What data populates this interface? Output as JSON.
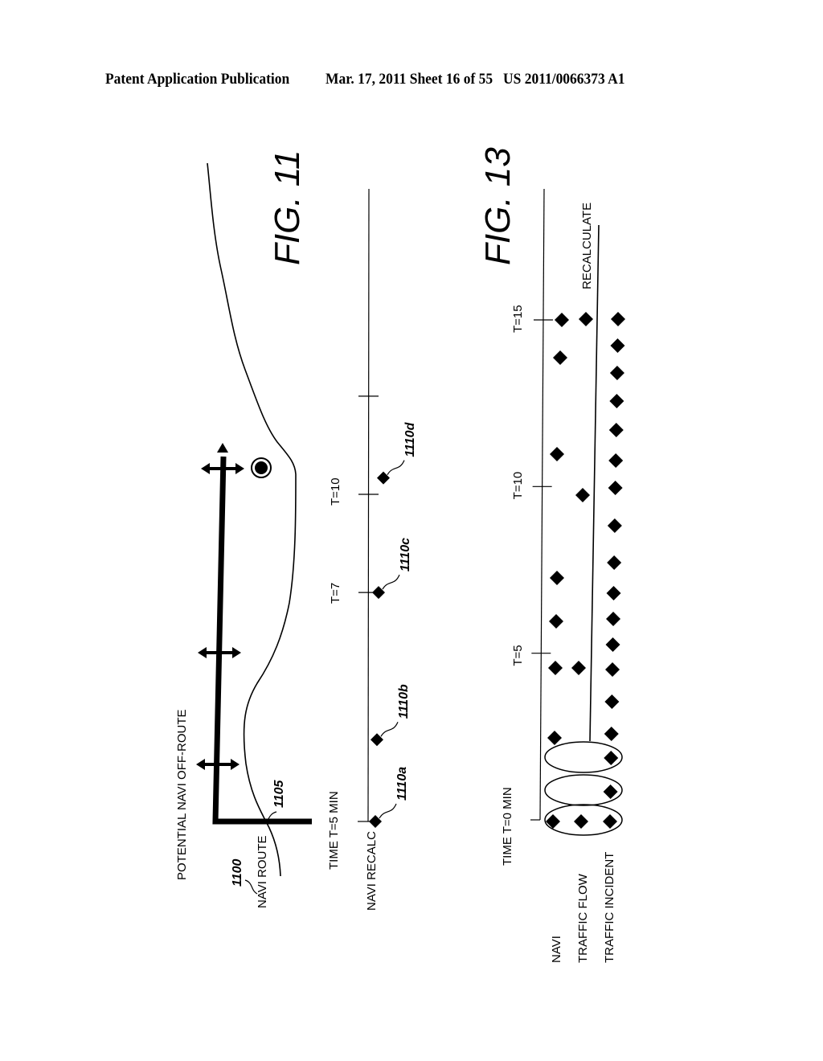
{
  "header": {
    "left": "Patent Application Publication",
    "middle": "Mar. 17, 2011  Sheet 16 of 55",
    "right": "US 2011/0066373 A1"
  },
  "fig11": {
    "title": "FIG. 11",
    "map": {
      "potential_label": "POTENTIAL NAVI OFF-ROUTE",
      "route_label": "NAVI ROUTE",
      "ref_route": "1100",
      "ref_junction": "1105",
      "icons": [
        "four-way-arrow-icon",
        "two-way-arrow-icon",
        "two-way-arrow-icon",
        "destination-target-icon"
      ]
    },
    "timeline": {
      "axis_label": "TIME T=5 MIN",
      "row_label": "NAVI RECALC",
      "ticks": [
        {
          "t": 0,
          "label": ""
        },
        {
          "t": 7,
          "label": "T=7"
        },
        {
          "t": 10,
          "label": "T=10"
        },
        {
          "t": 13,
          "label": ""
        }
      ],
      "events": [
        {
          "t": 0,
          "ref": "1110a"
        },
        {
          "t": 2.5,
          "ref": "1110b"
        },
        {
          "t": 7,
          "ref": "1110c"
        },
        {
          "t": 10.5,
          "ref": "1110d"
        }
      ]
    }
  },
  "fig13": {
    "title": "FIG. 13",
    "axis_label": "TIME T=0 MIN",
    "recalc_label": "RECALCULATE",
    "ticks": [
      {
        "t": 0,
        "label": ""
      },
      {
        "t": 5,
        "label": "T=5"
      },
      {
        "t": 10,
        "label": "T=10"
      },
      {
        "t": 15,
        "label": "T=15"
      }
    ],
    "rows": [
      {
        "name": "NAVI",
        "events": [
          0,
          2,
          5,
          6.7,
          8.3,
          11.5,
          14.2,
          15
        ]
      },
      {
        "name": "TRAFFIC FLOW",
        "events": [
          0,
          5,
          10.1,
          15.2
        ]
      },
      {
        "name": "TRAFFIC INCIDENT",
        "events": [
          0,
          1.2,
          2.3,
          3.3,
          4.3,
          5,
          5.9,
          6.8,
          7.7,
          8.8,
          10.0,
          11.1,
          12.2,
          13.2,
          14.2,
          15.5,
          16.5,
          17.0
        ]
      }
    ],
    "grouped_intervals": [
      "0-1",
      "1-2",
      "2-3"
    ]
  }
}
